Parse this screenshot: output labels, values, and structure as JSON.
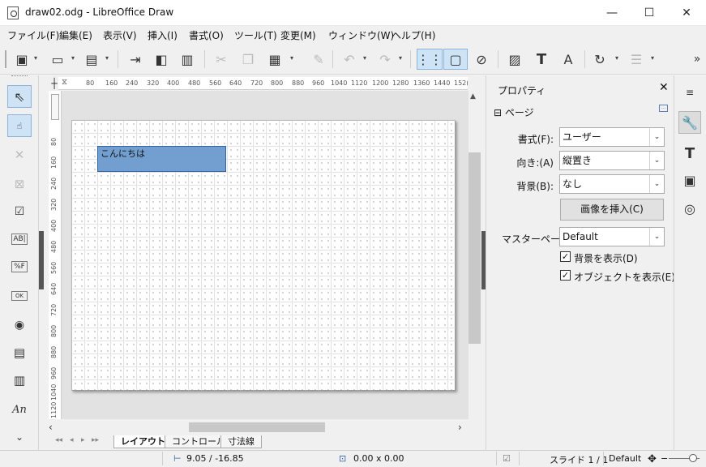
{
  "window": {
    "title": "draw02.odg - LibreOffice Draw",
    "minimize": "—",
    "maximize": "☐",
    "close": "✕"
  },
  "menu": [
    "ファイル(F)",
    "編集(E)",
    "表示(V)",
    "挿入(I)",
    "書式(O)",
    "ツール(T)",
    "変更(M)",
    "ウィンドウ(W)",
    "ヘルプ(H)"
  ],
  "toolbar": {
    "overflow": "»"
  },
  "left_tools": {
    "fontwork": "An",
    "formatted": "%F",
    "text": "AB|",
    "ok": "OK"
  },
  "ruler": {
    "h": [
      "80",
      "160",
      "240",
      "320",
      "400",
      "480",
      "560",
      "640",
      "720",
      "800",
      "880",
      "960",
      "1040",
      "1120",
      "1200",
      "1280",
      "1360",
      "1440",
      "152("
    ],
    "v": [
      "80",
      "160",
      "240",
      "320",
      "400",
      "480",
      "560",
      "640",
      "720",
      "800",
      "880",
      "960",
      "1040",
      "1120"
    ]
  },
  "canvas": {
    "shape_text": "こんにちは",
    "shape_color": "#729fcf"
  },
  "tabs": [
    "レイアウト",
    "コントロール",
    "寸法線"
  ],
  "sidebar": {
    "title": "プロパティ",
    "close": "✕",
    "section": "ページ",
    "format_label": "書式(F):",
    "format_value": "ユーザー",
    "orientation_label": "向き:(A)",
    "orientation_value": "縦置き",
    "background_label": "背景(B):",
    "background_value": "なし",
    "insert_image": "画像を挿入(C)",
    "master_label": "マスターページ",
    "master_value": "Default",
    "show_bg": "背景を表示(D)",
    "show_objects": "オブジェクトを表示(E)"
  },
  "status": {
    "position": "9.05 / -16.85",
    "size": "0.00 x 0.00",
    "slide": "スライド 1 / 1",
    "master": "Default"
  }
}
